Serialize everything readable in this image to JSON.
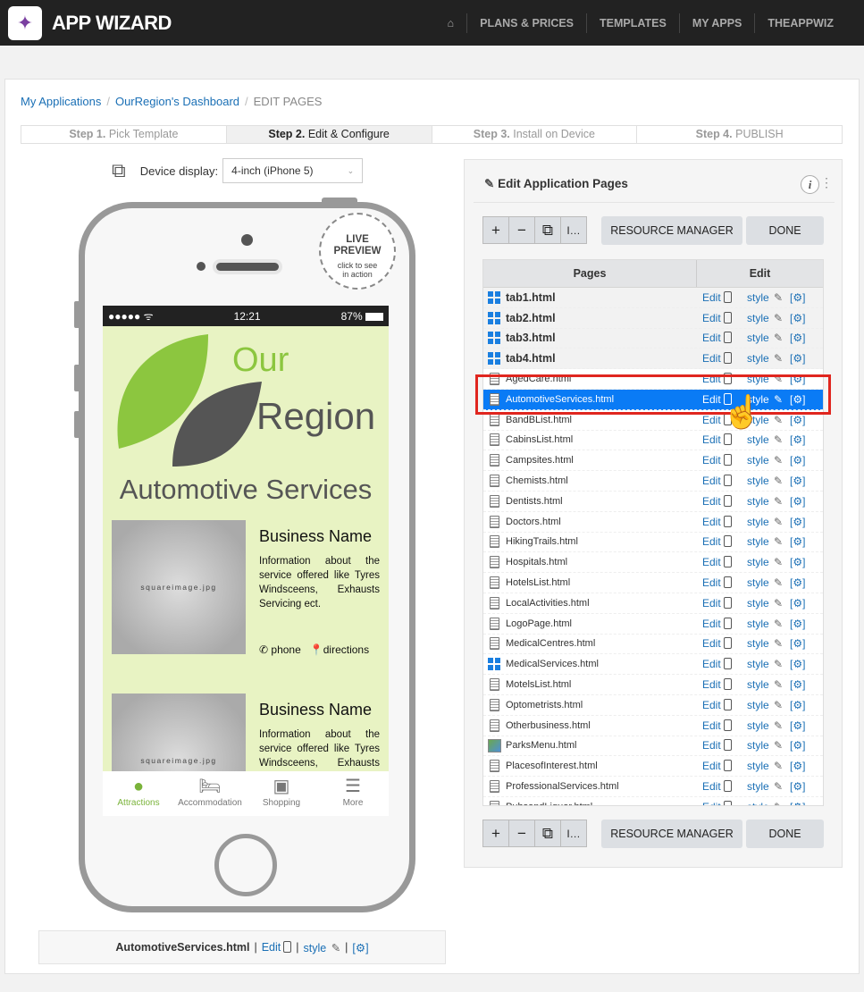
{
  "header": {
    "brand": "APP WIZARD",
    "nav": [
      "PLANS & PRICES",
      "TEMPLATES",
      "MY APPS",
      "THEAPPWIZ"
    ]
  },
  "breadcrumb": {
    "items": [
      "My Applications",
      "OurRegion's Dashboard"
    ],
    "current": "EDIT PAGES"
  },
  "steps": [
    {
      "num": "Step 1.",
      "label": "Pick Template"
    },
    {
      "num": "Step 2.",
      "label": "Edit & Configure"
    },
    {
      "num": "Step 3.",
      "label": "Install on Device"
    },
    {
      "num": "Step 4.",
      "label": "PUBLISH"
    }
  ],
  "device": {
    "label": "Device display:",
    "selected": "4-inch (iPhone 5)"
  },
  "live_preview": {
    "line1": "LIVE",
    "line2": "PREVIEW",
    "line3": "click to see",
    "line4": "in action"
  },
  "phone": {
    "time": "12:21",
    "battery": "87%",
    "signal": "●●●●● ᯤ",
    "logo_our": "Our",
    "logo_region": "Region",
    "page_title": "Automotive Services",
    "listings": [
      {
        "image": "squareimage.jpg",
        "name": "Business Name",
        "desc": "Information about the service offered like Tyres Windsceens, Exhausts Servicing ect.",
        "phone": "phone",
        "directions": "directions"
      },
      {
        "image": "squareimage.jpg",
        "name": "Business Name",
        "desc": "Information about the service offered like Tyres Windsceens, Exhausts Servicing ect."
      }
    ],
    "tabs": [
      "Attractions",
      "Accommodation",
      "Shopping",
      "More"
    ]
  },
  "panel": {
    "title": "Edit Application Pages",
    "resource_manager": "RESOURCE MANAGER",
    "done": "DONE",
    "col_pages": "Pages",
    "col_edit": "Edit",
    "edit_label": "Edit",
    "style_label": "style",
    "settings_label": "[⚙]",
    "pages": [
      {
        "name": "tab1.html",
        "icon": "grid"
      },
      {
        "name": "tab2.html",
        "icon": "grid"
      },
      {
        "name": "tab3.html",
        "icon": "grid"
      },
      {
        "name": "tab4.html",
        "icon": "grid"
      },
      {
        "name": "AgedCare.html",
        "icon": "doc"
      },
      {
        "name": "AutomotiveServices.html",
        "icon": "doc",
        "selected": true
      },
      {
        "name": "BandBList.html",
        "icon": "doc"
      },
      {
        "name": "CabinsList.html",
        "icon": "doc"
      },
      {
        "name": "Campsites.html",
        "icon": "doc"
      },
      {
        "name": "Chemists.html",
        "icon": "doc"
      },
      {
        "name": "Dentists.html",
        "icon": "doc"
      },
      {
        "name": "Doctors.html",
        "icon": "doc"
      },
      {
        "name": "HikingTrails.html",
        "icon": "doc"
      },
      {
        "name": "Hospitals.html",
        "icon": "doc"
      },
      {
        "name": "HotelsList.html",
        "icon": "doc"
      },
      {
        "name": "LocalActivities.html",
        "icon": "doc"
      },
      {
        "name": "LogoPage.html",
        "icon": "doc"
      },
      {
        "name": "MedicalCentres.html",
        "icon": "doc"
      },
      {
        "name": "MedicalServices.html",
        "icon": "grid"
      },
      {
        "name": "MotelsList.html",
        "icon": "doc"
      },
      {
        "name": "Optometrists.html",
        "icon": "doc"
      },
      {
        "name": "Otherbusiness.html",
        "icon": "doc"
      },
      {
        "name": "ParksMenu.html",
        "icon": "image"
      },
      {
        "name": "PlacesofInterest.html",
        "icon": "doc"
      },
      {
        "name": "ProfessionalServices.html",
        "icon": "doc"
      },
      {
        "name": "PubsandLiquor.html",
        "icon": "doc"
      }
    ]
  },
  "footer": {
    "page": "AutomotiveServices.html",
    "edit": "Edit",
    "style": "style",
    "settings": "[⚙]"
  },
  "colors": {
    "header": "#222222",
    "link": "#1a6fb5",
    "selected_row": "#0a7bf5",
    "highlight": "#e0261f",
    "screen_bg": "#e8f3c3",
    "accent_green": "#7ab33a"
  }
}
